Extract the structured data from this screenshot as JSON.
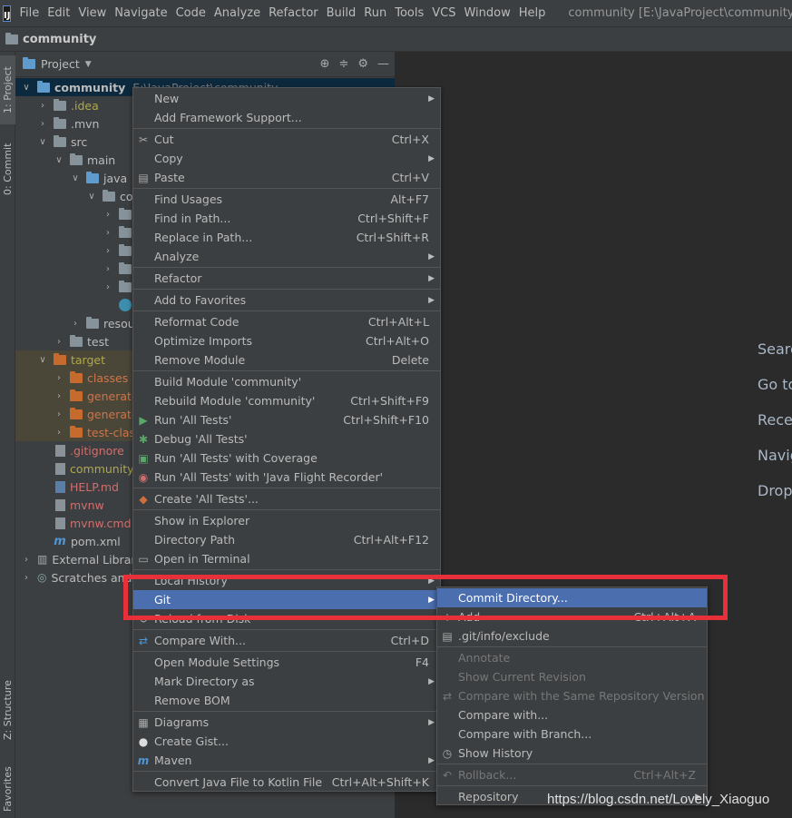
{
  "menubar": {
    "logo": "IJ",
    "items": [
      "File",
      "Edit",
      "View",
      "Navigate",
      "Code",
      "Analyze",
      "Refactor",
      "Build",
      "Run",
      "Tools",
      "VCS",
      "Window",
      "Help"
    ],
    "window_title": "community [E:\\JavaProject\\community]"
  },
  "navbar": {
    "project": "community"
  },
  "left_strip": {
    "project_tab": "1: Project",
    "commit_tab": "0: Commit",
    "structure_tab": "Z: Structure",
    "favorites_tab": "Favorites"
  },
  "panel": {
    "title": "Project"
  },
  "tree": {
    "root_name": "community",
    "root_path": "E:\\JavaProject\\community",
    "rows": [
      {
        "label": "community"
      },
      {
        "label": ".idea"
      },
      {
        "label": ".mvn"
      },
      {
        "label": "src"
      },
      {
        "label": "main"
      },
      {
        "label": "java"
      },
      {
        "label": "co"
      },
      {
        "label": ""
      },
      {
        "label": ""
      },
      {
        "label": ""
      },
      {
        "label": ""
      },
      {
        "label": ""
      },
      {
        "label": ""
      },
      {
        "label": "resou"
      },
      {
        "label": "test"
      },
      {
        "label": "target"
      },
      {
        "label": "classes"
      },
      {
        "label": "generate"
      },
      {
        "label": "generate"
      },
      {
        "label": "test-clas"
      },
      {
        "label": ".gitignore"
      },
      {
        "label": "community."
      },
      {
        "label": "HELP.md"
      },
      {
        "label": "mvnw"
      },
      {
        "label": "mvnw.cmd"
      },
      {
        "label": "pom.xml"
      },
      {
        "label": "External Librar"
      },
      {
        "label": "Scratches and"
      }
    ]
  },
  "editor_hints": [
    "Searc",
    "Go to",
    "Recer",
    "Navig",
    "Drop"
  ],
  "context_menu": {
    "items": [
      {
        "label": "New",
        "shortcut": "",
        "submenu": true,
        "icon": ""
      },
      {
        "label": "Add Framework Support...",
        "shortcut": "",
        "submenu": false,
        "icon": ""
      },
      {
        "label": "Cut",
        "shortcut": "Ctrl+X",
        "submenu": false,
        "icon": "✂"
      },
      {
        "label": "Copy",
        "shortcut": "",
        "submenu": true,
        "icon": ""
      },
      {
        "label": "Paste",
        "shortcut": "Ctrl+V",
        "submenu": false,
        "icon": "📋"
      },
      {
        "label": "Find Usages",
        "shortcut": "Alt+F7",
        "submenu": false,
        "icon": ""
      },
      {
        "label": "Find in Path...",
        "shortcut": "Ctrl+Shift+F",
        "submenu": false,
        "icon": ""
      },
      {
        "label": "Replace in Path...",
        "shortcut": "Ctrl+Shift+R",
        "submenu": false,
        "icon": ""
      },
      {
        "label": "Analyze",
        "shortcut": "",
        "submenu": true,
        "icon": ""
      },
      {
        "label": "Refactor",
        "shortcut": "",
        "submenu": true,
        "icon": ""
      },
      {
        "label": "Add to Favorites",
        "shortcut": "",
        "submenu": true,
        "icon": ""
      },
      {
        "label": "Reformat Code",
        "shortcut": "Ctrl+Alt+L",
        "submenu": false,
        "icon": ""
      },
      {
        "label": "Optimize Imports",
        "shortcut": "Ctrl+Alt+O",
        "submenu": false,
        "icon": ""
      },
      {
        "label": "Remove Module",
        "shortcut": "Delete",
        "submenu": false,
        "icon": ""
      },
      {
        "label": "Build Module 'community'",
        "shortcut": "",
        "submenu": false,
        "icon": ""
      },
      {
        "label": "Rebuild Module 'community'",
        "shortcut": "Ctrl+Shift+F9",
        "submenu": false,
        "icon": ""
      },
      {
        "label": "Run 'All Tests'",
        "shortcut": "Ctrl+Shift+F10",
        "submenu": false,
        "icon": "▶"
      },
      {
        "label": "Debug 'All Tests'",
        "shortcut": "",
        "submenu": false,
        "icon": "🐞"
      },
      {
        "label": "Run 'All Tests' with Coverage",
        "shortcut": "",
        "submenu": false,
        "icon": "▣"
      },
      {
        "label": "Run 'All Tests' with 'Java Flight Recorder'",
        "shortcut": "",
        "submenu": false,
        "icon": "◉"
      },
      {
        "label": "Create 'All Tests'...",
        "shortcut": "",
        "submenu": false,
        "icon": "◆"
      },
      {
        "label": "Show in Explorer",
        "shortcut": "",
        "submenu": false,
        "icon": ""
      },
      {
        "label": "Directory Path",
        "shortcut": "Ctrl+Alt+F12",
        "submenu": false,
        "icon": ""
      },
      {
        "label": "Open in Terminal",
        "shortcut": "",
        "submenu": false,
        "icon": ""
      },
      {
        "label": "Local History",
        "shortcut": "",
        "submenu": true,
        "icon": ""
      },
      {
        "label": "Git",
        "shortcut": "",
        "submenu": true,
        "icon": ""
      },
      {
        "label": "Reload from Disk",
        "shortcut": "",
        "submenu": false,
        "icon": "↻"
      },
      {
        "label": "Compare With...",
        "shortcut": "Ctrl+D",
        "submenu": false,
        "icon": "⇄"
      },
      {
        "label": "Open Module Settings",
        "shortcut": "F4",
        "submenu": false,
        "icon": ""
      },
      {
        "label": "Mark Directory as",
        "shortcut": "",
        "submenu": true,
        "icon": ""
      },
      {
        "label": "Remove BOM",
        "shortcut": "",
        "submenu": false,
        "icon": ""
      },
      {
        "label": "Diagrams",
        "shortcut": "",
        "submenu": true,
        "icon": "▦"
      },
      {
        "label": "Create Gist...",
        "shortcut": "",
        "submenu": false,
        "icon": "●"
      },
      {
        "label": "Maven",
        "shortcut": "",
        "submenu": true,
        "icon": "m"
      },
      {
        "label": "Convert Java File to Kotlin File",
        "shortcut": "Ctrl+Alt+Shift+K",
        "submenu": false,
        "icon": ""
      }
    ]
  },
  "git_submenu": {
    "items": [
      {
        "label": "Commit Directory...",
        "shortcut": "",
        "icon": ""
      },
      {
        "label": "Add",
        "shortcut": "Ctrl+Alt+A",
        "icon": "+"
      },
      {
        "label": ".git/info/exclude",
        "shortcut": "",
        "icon": "▤"
      },
      {
        "label": "Annotate",
        "shortcut": "",
        "icon": ""
      },
      {
        "label": "Show Current Revision",
        "shortcut": "",
        "icon": ""
      },
      {
        "label": "Compare with the Same Repository Version",
        "shortcut": "",
        "icon": "⇄"
      },
      {
        "label": "Compare with...",
        "shortcut": "",
        "icon": ""
      },
      {
        "label": "Compare with Branch...",
        "shortcut": "",
        "icon": ""
      },
      {
        "label": "Show History",
        "shortcut": "",
        "icon": "◷"
      },
      {
        "label": "Rollback...",
        "shortcut": "Ctrl+Alt+Z",
        "icon": "↶"
      },
      {
        "label": "Repository",
        "shortcut": "",
        "icon": ""
      }
    ]
  },
  "watermark": "https://blog.csdn.net/Lovely_Xiaoguo"
}
